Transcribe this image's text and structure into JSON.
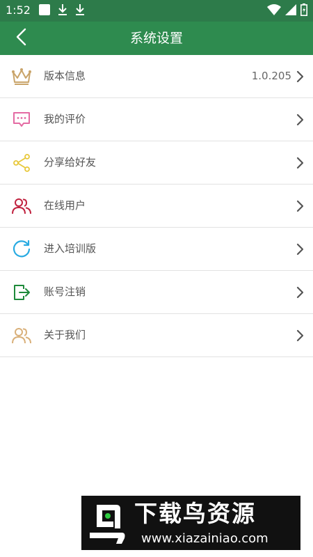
{
  "status_bar": {
    "time": "1:52",
    "icons_left": [
      "notification-square-icon",
      "download-icon",
      "download-icon"
    ],
    "icons_right": [
      "wifi-icon",
      "cell-signal-icon",
      "battery-icon"
    ]
  },
  "header": {
    "title": "系统设置",
    "back_icon": "chevron-left-icon",
    "background": "#2e8b4f"
  },
  "settings": {
    "items": [
      {
        "label": "版本信息",
        "value": "1.0.205",
        "icon": "crown-icon",
        "icon_color": "#c9a46a"
      },
      {
        "label": "我的评价",
        "icon": "comment-icon",
        "icon_color": "#e46aa3"
      },
      {
        "label": "分享给好友",
        "icon": "share-icon",
        "icon_color": "#e8c83a"
      },
      {
        "label": "在线用户",
        "icon": "users-icon",
        "icon_color": "#c0213e"
      },
      {
        "label": "进入培训版",
        "icon": "refresh-icon",
        "icon_color": "#29abe2"
      },
      {
        "label": "账号注销",
        "icon": "logout-icon",
        "icon_color": "#1e8a3a"
      },
      {
        "label": "关于我们",
        "icon": "users-icon",
        "icon_color": "#d9b07a"
      }
    ]
  },
  "watermark": {
    "title": "下载鸟资源",
    "url": "www.xiazainiao.com"
  }
}
